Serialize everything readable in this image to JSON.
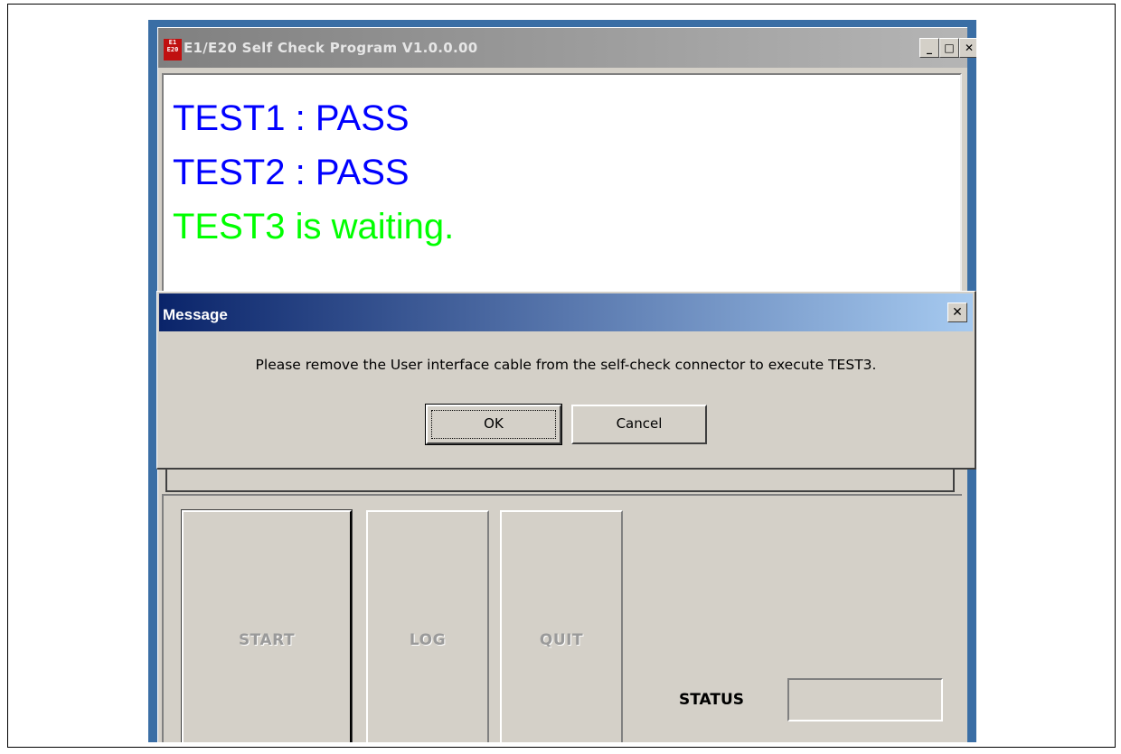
{
  "app": {
    "icon_text": "E1 E20",
    "title": "E1/E20 Self Check Program V1.0.0.00",
    "window_controls": {
      "minimize": "_",
      "maximize": "□",
      "close": "✕"
    }
  },
  "output": {
    "lines": [
      {
        "text": "TEST1 : PASS",
        "color": "#0000ff"
      },
      {
        "text": "TEST2 : PASS",
        "color": "#0000ff"
      },
      {
        "text": "TEST3 is waiting.",
        "color": "#00ff00"
      }
    ]
  },
  "buttons": {
    "start": "START",
    "log": "LOG",
    "quit": "QUIT"
  },
  "status": {
    "label": "STATUS",
    "value": ""
  },
  "dialog": {
    "title": "Message",
    "close": "✕",
    "message": "Please remove the User interface cable from the self-check connector to execute TEST3.",
    "ok": "OK",
    "cancel": "Cancel"
  },
  "colors": {
    "desktop": "#3a6ea5",
    "window_face": "#d4d0c8",
    "dialog_title_start": "#0a246a",
    "dialog_title_end": "#a6caf0"
  }
}
